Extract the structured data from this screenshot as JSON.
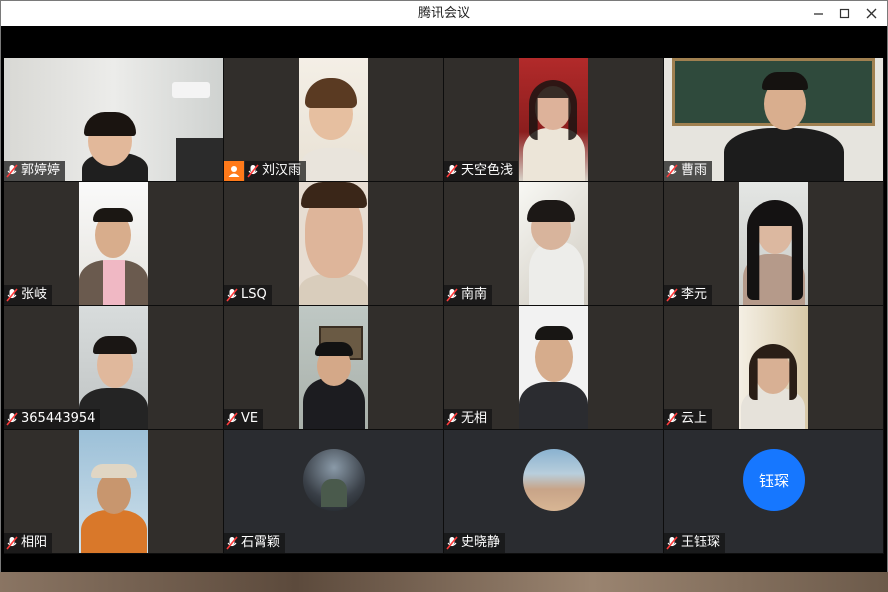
{
  "window": {
    "title": "腾讯会议"
  },
  "participants": [
    {
      "name": "郭婷婷"
    },
    {
      "name": "刘汉雨",
      "host": true
    },
    {
      "name": "天空色浅"
    },
    {
      "name": "曹雨"
    },
    {
      "name": "张岐"
    },
    {
      "name": "LSQ"
    },
    {
      "name": "南南"
    },
    {
      "name": "李元"
    },
    {
      "name": "365443954"
    },
    {
      "name": "VE"
    },
    {
      "name": "无相"
    },
    {
      "name": "云上"
    },
    {
      "name": "相阳"
    },
    {
      "name": "石霄颖"
    },
    {
      "name": "史晓静"
    },
    {
      "name": "王钰琛",
      "avatar_text": "钰琛"
    }
  ],
  "colors": {
    "avatar_blue": "#1677ff",
    "host_badge": "#ff7a1a"
  }
}
